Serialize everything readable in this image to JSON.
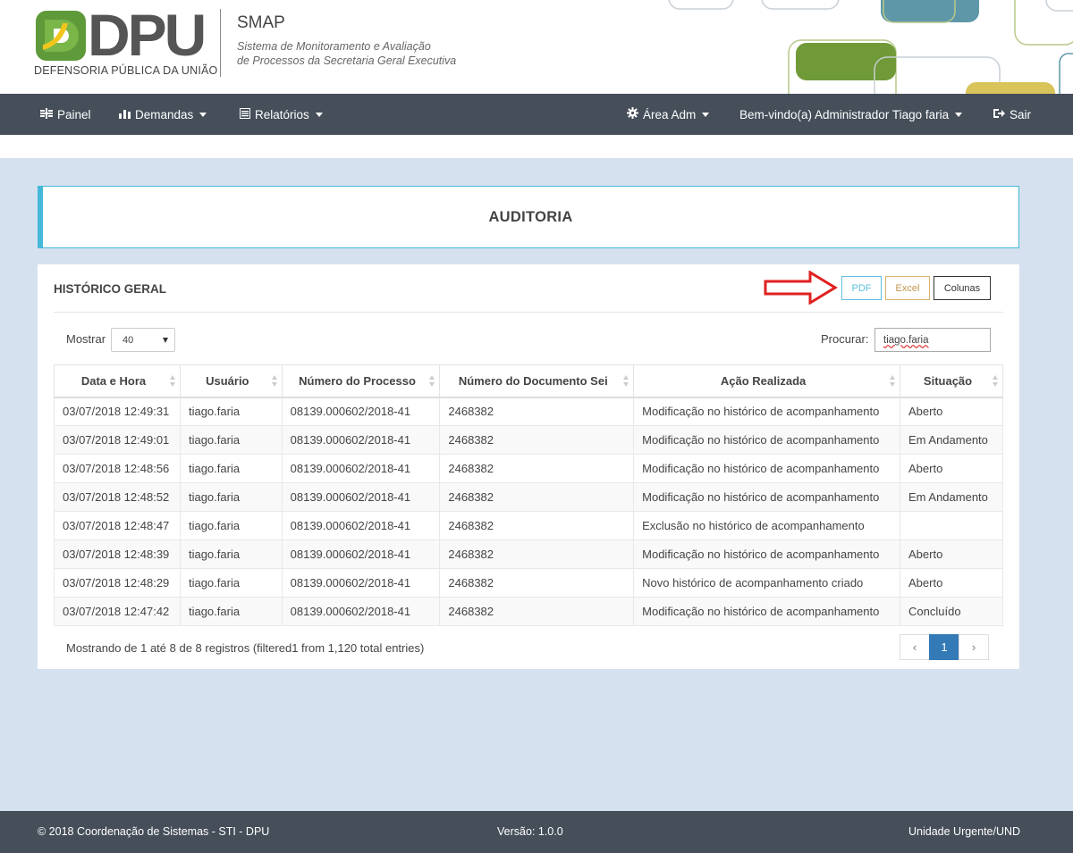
{
  "header": {
    "logo_text": "DPU",
    "logo_subtitle": "DEFENSORIA PÚBLICA DA UNIÃO",
    "app_name": "SMAP",
    "app_desc_line1": "Sistema de Monitoramento e Avaliação",
    "app_desc_line2": "de Processos da Secretaria Geral Executiva"
  },
  "nav": {
    "painel": "Painel",
    "demandas": "Demandas",
    "relatorios": "Relatórios",
    "area_adm": "Área Adm",
    "user": "Bem-vindo(a) Administrador Tiago faria",
    "sair": "Sair"
  },
  "page_title": "AUDITORIA",
  "panel": {
    "title": "HISTÓRICO GERAL",
    "buttons": {
      "pdf": "PDF",
      "excel": "Excel",
      "columns": "Colunas"
    },
    "show_label": "Mostrar",
    "show_value": "40",
    "search_label": "Procurar:",
    "search_value": "tiago.faria"
  },
  "table": {
    "columns": [
      "Data e Hora",
      "Usuário",
      "Número do Processo",
      "Número do Documento Sei",
      "Ação Realizada",
      "Situação"
    ],
    "rows": [
      [
        "03/07/2018 12:49:31",
        "tiago.faria",
        "08139.000602/2018-41",
        "2468382",
        "Modificação no histórico de acompanhamento",
        "Aberto"
      ],
      [
        "03/07/2018 12:49:01",
        "tiago.faria",
        "08139.000602/2018-41",
        "2468382",
        "Modificação no histórico de acompanhamento",
        "Em Andamento"
      ],
      [
        "03/07/2018 12:48:56",
        "tiago.faria",
        "08139.000602/2018-41",
        "2468382",
        "Modificação no histórico de acompanhamento",
        "Aberto"
      ],
      [
        "03/07/2018 12:48:52",
        "tiago.faria",
        "08139.000602/2018-41",
        "2468382",
        "Modificação no histórico de acompanhamento",
        "Em Andamento"
      ],
      [
        "03/07/2018 12:48:47",
        "tiago.faria",
        "08139.000602/2018-41",
        "2468382",
        "Exclusão no histórico de acompanhamento",
        ""
      ],
      [
        "03/07/2018 12:48:39",
        "tiago.faria",
        "08139.000602/2018-41",
        "2468382",
        "Modificação no histórico de acompanhamento",
        "Aberto"
      ],
      [
        "03/07/2018 12:48:29",
        "tiago.faria",
        "08139.000602/2018-41",
        "2468382",
        "Novo histórico de acompanhamento criado",
        "Aberto"
      ],
      [
        "03/07/2018 12:47:42",
        "tiago.faria",
        "08139.000602/2018-41",
        "2468382",
        "Modificação no histórico de acompanhamento",
        "Concluído"
      ]
    ]
  },
  "info": "Mostrando de 1 até 8 de 8 registros (filtered1 from 1,120 total entries)",
  "pagination": {
    "prev": "‹",
    "page": "1",
    "next": "›"
  },
  "footer": {
    "copyright": "© 2018 Coordenação de Sistemas - STI - DPU",
    "version": "Versão: 1.0.0",
    "unit": "Unidade Urgente/UND"
  },
  "colors": {
    "navbar": "#454e59",
    "background": "#d5e1ef",
    "accent_info": "#46b8da",
    "pdf": "#5bc0de",
    "excel": "#c0954a",
    "pager_active": "#337ab7",
    "arrow": "#e02020"
  }
}
